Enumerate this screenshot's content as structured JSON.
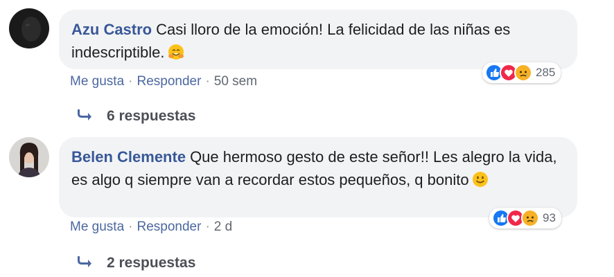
{
  "comments": [
    {
      "author": "Azu Castro",
      "text": "Casi lloro de la emoción! La felicidad de las niñas es indescriptible.",
      "emoji": "hugging-face-emoji",
      "like_label": "Me gusta",
      "reply_label": "Responder",
      "time": "50 sem",
      "reaction_count": "285",
      "replies_label": "6 respuestas"
    },
    {
      "author": "Belen Clemente",
      "text": "Que hermoso gesto de este señor!! Les alegro la vida, es algo q siempre van a recordar estos pequeños, q bonito",
      "emoji": "smiling-face-emoji",
      "like_label": "Me gusta",
      "reply_label": "Responder",
      "time": "2 d",
      "reaction_count": "93",
      "replies_label": "2 respuestas"
    }
  ],
  "colors": {
    "author": "#385898",
    "bubble": "#f2f3f5",
    "like_blue": "#1877f2",
    "love_red": "#f0284a",
    "sad_yellow": "#f7b125"
  }
}
